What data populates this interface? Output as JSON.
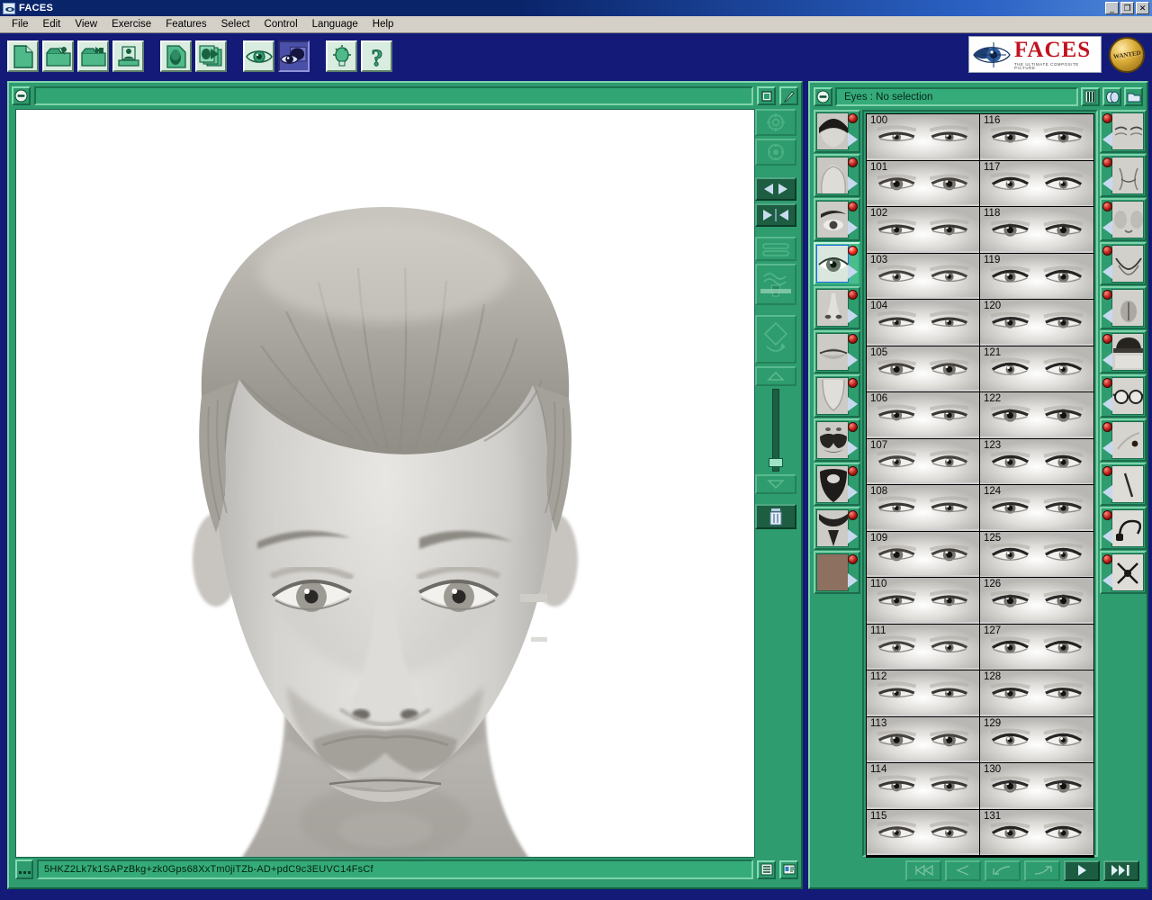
{
  "window": {
    "title": "FACES",
    "icon": "faces-eye-icon",
    "controls": [
      {
        "name": "minimize",
        "glyph": "_"
      },
      {
        "name": "maximize",
        "glyph": "❐"
      },
      {
        "name": "close",
        "glyph": "✕"
      }
    ]
  },
  "menu": [
    {
      "label": "File"
    },
    {
      "label": "Edit"
    },
    {
      "label": "View"
    },
    {
      "label": "Exercise"
    },
    {
      "label": "Features"
    },
    {
      "label": "Select"
    },
    {
      "label": "Control"
    },
    {
      "label": "Language"
    },
    {
      "label": "Help"
    }
  ],
  "toolbar": {
    "buttons": [
      {
        "name": "new-document-icon",
        "active": false
      },
      {
        "name": "open-folder-icon",
        "active": false
      },
      {
        "name": "save-folder-icon",
        "active": false
      },
      {
        "name": "export-portrait-icon",
        "active": false
      },
      {
        "name": "new-face-document-icon",
        "active": false
      },
      {
        "name": "play-slideshow-icon",
        "active": false
      },
      {
        "name": "eye-view-icon",
        "active": false
      },
      {
        "name": "eyes-compare-icon",
        "active": true
      },
      {
        "name": "lightbulb-hint-icon",
        "active": false
      },
      {
        "name": "help-question-icon",
        "active": false
      }
    ],
    "logo": {
      "word": "FACES",
      "tagline": "THE ULTIMATE COMPOSITE PICTURE",
      "badge_text": "WANTED"
    }
  },
  "face_panel": {
    "title": "",
    "minimize_icon": "minimize-icon",
    "header_buttons": [
      {
        "name": "window-view-icon"
      },
      {
        "name": "pen-edit-icon"
      }
    ],
    "tools": [
      {
        "name": "zoom-in-tool",
        "enabled": false
      },
      {
        "name": "zoom-out-tool",
        "enabled": false
      },
      {
        "name": "move-left-right-tool",
        "enabled": true
      },
      {
        "name": "mirror-flip-tool",
        "enabled": true
      },
      {
        "name": "stretch-tool",
        "enabled": false
      },
      {
        "name": "smudge-tool",
        "enabled": false
      },
      {
        "name": "rotate-tool",
        "enabled": false
      },
      {
        "name": "scroll-up-button",
        "enabled": false
      },
      {
        "name": "opacity-slider",
        "enabled": true,
        "value": 18
      },
      {
        "name": "scroll-down-button",
        "enabled": false
      },
      {
        "name": "delete-trash-tool",
        "enabled": true
      }
    ],
    "status": {
      "code": "5HKZ2Lk7k1SAPzBkg+zk0Gps68XxTm0jiTZb-AD+pdC9c3EUVC14FsCf",
      "buttons": [
        {
          "name": "list-view-icon"
        },
        {
          "name": "id-card-icon"
        }
      ]
    }
  },
  "features_panel": {
    "title": "Eyes : No selection",
    "minimize_icon": "minimize-icon",
    "header_buttons": [
      {
        "name": "film-strip-icon"
      },
      {
        "name": "faces-group-icon"
      },
      {
        "name": "open-folder-icon"
      }
    ],
    "left_features": [
      {
        "name": "feature-hair",
        "label": "Hair",
        "selected": false
      },
      {
        "name": "feature-head-shape",
        "label": "Head shape",
        "selected": false
      },
      {
        "name": "feature-eyebrows",
        "label": "Eyebrows",
        "selected": false
      },
      {
        "name": "feature-eyes",
        "label": "Eyes",
        "selected": true
      },
      {
        "name": "feature-nose",
        "label": "Nose",
        "selected": false
      },
      {
        "name": "feature-mouth",
        "label": "Mouth",
        "selected": false
      },
      {
        "name": "feature-chin",
        "label": "Chin",
        "selected": false
      },
      {
        "name": "feature-mustache",
        "label": "Mustache",
        "selected": false
      },
      {
        "name": "feature-beard",
        "label": "Beard",
        "selected": false
      },
      {
        "name": "feature-goatee",
        "label": "Goatee",
        "selected": false
      },
      {
        "name": "feature-skin-tone",
        "label": "Skin tone",
        "selected": false
      }
    ],
    "right_features": [
      {
        "name": "feature-eye-wrinkles",
        "label": "Eye wrinkles"
      },
      {
        "name": "feature-mouth-wrinkles",
        "label": "Mouth wrinkles"
      },
      {
        "name": "feature-cheeks",
        "label": "Cheeks"
      },
      {
        "name": "feature-face-lines",
        "label": "Face lines"
      },
      {
        "name": "feature-chin-detail",
        "label": "Chin detail"
      },
      {
        "name": "feature-hat",
        "label": "Hat"
      },
      {
        "name": "feature-glasses",
        "label": "Glasses"
      },
      {
        "name": "feature-mole",
        "label": "Mole"
      },
      {
        "name": "feature-scar",
        "label": "Scar"
      },
      {
        "name": "feature-headset",
        "label": "Headset"
      },
      {
        "name": "feature-tattoo",
        "label": "Tattoo"
      }
    ],
    "grid": {
      "columns": 2,
      "items": [
        {
          "id": "100"
        },
        {
          "id": "116"
        },
        {
          "id": "101"
        },
        {
          "id": "117"
        },
        {
          "id": "102"
        },
        {
          "id": "118"
        },
        {
          "id": "103"
        },
        {
          "id": "119"
        },
        {
          "id": "104"
        },
        {
          "id": "120"
        },
        {
          "id": "105"
        },
        {
          "id": "121"
        },
        {
          "id": "106"
        },
        {
          "id": "122"
        },
        {
          "id": "107"
        },
        {
          "id": "123"
        },
        {
          "id": "108"
        },
        {
          "id": "124"
        },
        {
          "id": "109"
        },
        {
          "id": "125"
        },
        {
          "id": "110"
        },
        {
          "id": "126"
        },
        {
          "id": "111"
        },
        {
          "id": "127"
        },
        {
          "id": "112"
        },
        {
          "id": "128"
        },
        {
          "id": "113"
        },
        {
          "id": "129"
        },
        {
          "id": "114"
        },
        {
          "id": "130"
        },
        {
          "id": "115"
        },
        {
          "id": "131"
        }
      ]
    },
    "nav_buttons": [
      {
        "name": "first-page-button",
        "enabled": false
      },
      {
        "name": "previous-page-button",
        "enabled": false
      },
      {
        "name": "previous-group-button",
        "enabled": false
      },
      {
        "name": "next-group-button",
        "enabled": false
      },
      {
        "name": "next-page-button",
        "enabled": true
      },
      {
        "name": "last-page-button",
        "enabled": true
      }
    ]
  },
  "colors": {
    "panel_green": "#2e9c6e",
    "toolbar_blue": "#141a78",
    "title_blue": "#0a246a",
    "accent_red": "#c1121f",
    "led_red": "#b41d18"
  }
}
